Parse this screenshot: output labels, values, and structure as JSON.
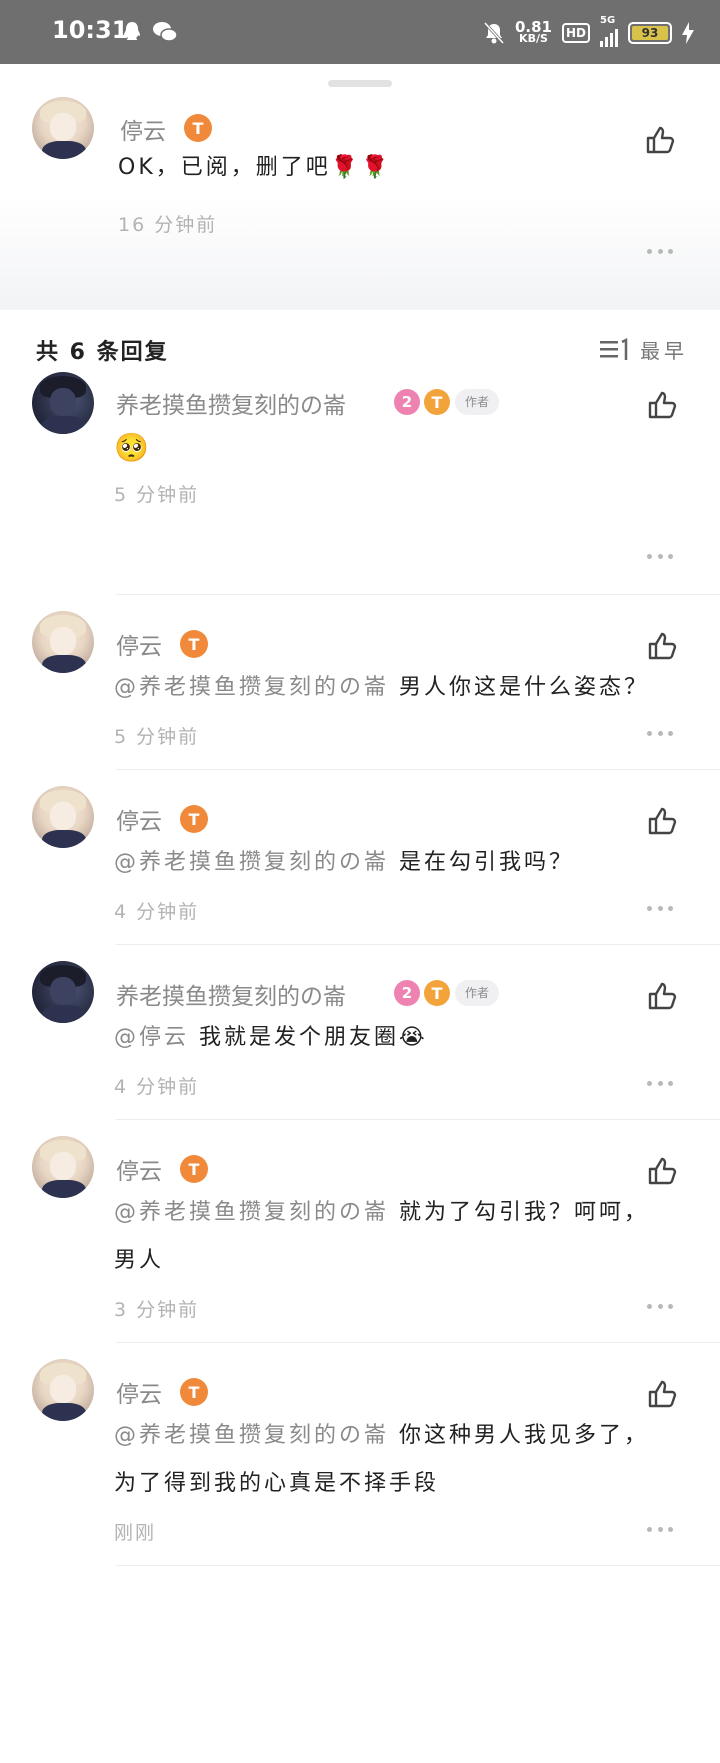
{
  "status_bar": {
    "time": "10:31",
    "net_speed": "0.81",
    "net_unit": "KB/S",
    "hd": "HD",
    "network": "5G",
    "battery": "93"
  },
  "top_comment": {
    "username": "停云",
    "badge": "T",
    "text": "OK，已阅，删了吧🌹🌹",
    "time": "16 分钟前"
  },
  "replies_header": {
    "count_label": "共 6 条回复",
    "sort_label": "最早"
  },
  "author_tag": "作者",
  "replies": [
    {
      "username": "养老摸鱼攒复刻的の崙",
      "level": "2",
      "badge": "T",
      "is_author": true,
      "mention": "",
      "text": "🥺",
      "time": "5 分钟前"
    },
    {
      "username": "停云",
      "badge": "T",
      "mention": "@养老摸鱼攒复刻的の崙",
      "text": "男人你这是什么姿态？",
      "time": "5 分钟前"
    },
    {
      "username": "停云",
      "badge": "T",
      "mention": "@养老摸鱼攒复刻的の崙",
      "text": "是在勾引我吗？",
      "time": "4 分钟前"
    },
    {
      "username": "养老摸鱼攒复刻的の崙",
      "level": "2",
      "badge": "T",
      "is_author": true,
      "mention": "@停云",
      "text": "我就是发个朋友圈😭",
      "time": "4 分钟前"
    },
    {
      "username": "停云",
      "badge": "T",
      "mention": "@养老摸鱼攒复刻的の崙",
      "text": "就为了勾引我？呵呵，",
      "text2": "男人",
      "time": "3 分钟前"
    },
    {
      "username": "停云",
      "badge": "T",
      "mention": "@养老摸鱼攒复刻的の崙",
      "text": "你这种男人我见多了，",
      "text2": "为了得到我的心真是不择手段",
      "time": "刚刚"
    }
  ]
}
